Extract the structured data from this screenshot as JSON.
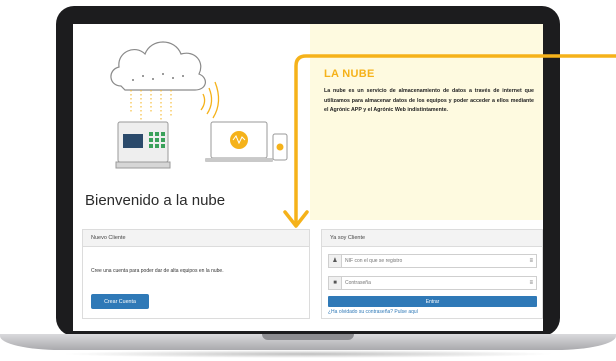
{
  "nube": {
    "title": "LA NUBE",
    "description": "La nube es un servicio de almacenamiento de datos a través de internet que utilizamos para almacenar datos de los equipos y poder acceder a ellos mediante el Agrónic APP y el Agrónic Web indistintamente."
  },
  "welcome": "Bienvenido a la nube",
  "nuevo_cliente": {
    "header": "Nuevo Cliente",
    "text": "Cree una cuenta para poder dar de alta equipos en la nube.",
    "button": "Crear Cuenta"
  },
  "ya_soy_cliente": {
    "header": "Ya soy Cliente",
    "nif_placeholder": "NIF con el que se registro",
    "password_placeholder": "Contraseña",
    "button": "Entrar",
    "forgot": "¿Ha olvidado su contraseña? Pulse aquí"
  },
  "colors": {
    "accent": "#f5b21a",
    "primary_button": "#2f79b7",
    "panel_bg": "#fefae0"
  },
  "icons": [
    "cloud-icon",
    "wifi-waves-icon",
    "controller-device-icon",
    "laptop-icon",
    "phone-icon",
    "user-icon",
    "lock-icon",
    "menu-icon"
  ]
}
